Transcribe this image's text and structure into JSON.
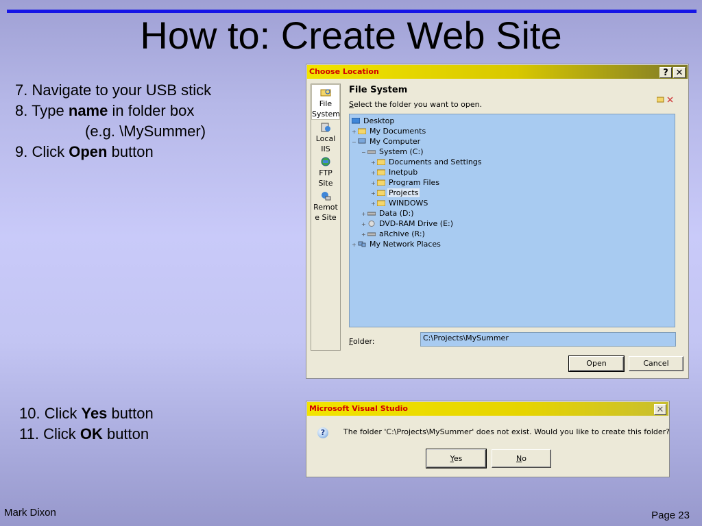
{
  "slide": {
    "title": "How to: Create Web Site",
    "steps_a": {
      "s7": "7. Navigate to your USB stick",
      "s8_pre": "8. Type ",
      "s8_bold": "name",
      "s8_post": " in folder box",
      "s8_example": "(e.g. \\MySummer)",
      "s9_pre": "9. Click ",
      "s9_bold": "Open",
      "s9_post": " button"
    },
    "steps_b": {
      "s10_pre": "10. Click ",
      "s10_bold": "Yes",
      "s10_post": " button",
      "s11_pre": "11. Click ",
      "s11_bold": "OK",
      "s11_post": " button"
    },
    "footer_left": "Mark Dixon",
    "footer_right": "Page 23"
  },
  "choose_location": {
    "title": "Choose Location",
    "help_glyph": "?",
    "close_glyph": "✕",
    "places": [
      {
        "label": "File System",
        "icon": "file-system-icon"
      },
      {
        "label": "Local IIS",
        "icon": "local-iis-icon"
      },
      {
        "label": "FTP Site",
        "icon": "ftp-site-icon"
      },
      {
        "label": "Remot e Site",
        "icon": "remote-site-icon"
      }
    ],
    "heading": "File System",
    "subtitle_mnemonic": "S",
    "subtitle_rest": "elect the folder you want to open.",
    "tree": [
      {
        "label": "Desktop",
        "exp": ""
      },
      {
        "label": "My Documents",
        "exp": "+"
      },
      {
        "label": "My Computer",
        "exp": "−"
      },
      {
        "label": "System (C:)",
        "exp": "−"
      },
      {
        "label": "Documents and Settings",
        "exp": "+"
      },
      {
        "label": "Inetpub",
        "exp": "+"
      },
      {
        "label": "Program Files",
        "exp": "+"
      },
      {
        "label": "Projects",
        "exp": "+"
      },
      {
        "label": "WINDOWS",
        "exp": "+"
      },
      {
        "label": "Data (D:)",
        "exp": "+"
      },
      {
        "label": "DVD-RAM Drive (E:)",
        "exp": "+"
      },
      {
        "label": "aRchive (R:)",
        "exp": "+"
      },
      {
        "label": "My Network Places",
        "exp": "+"
      }
    ],
    "folder_label_mnemonic": "F",
    "folder_label_rest": "older:",
    "folder_value": "C:\\Projects\\MySummer",
    "open_label": "Open",
    "cancel_label": "Cancel"
  },
  "msvs_dialog": {
    "title": "Microsoft Visual Studio",
    "close_glyph": "✕",
    "icon": "question-icon",
    "icon_glyph": "?",
    "message": "The folder 'C:\\Projects\\MySummer' does not exist. Would you like to create this folder?",
    "yes_mnemonic": "Y",
    "yes_rest": "es",
    "no_mnemonic": "N",
    "no_rest": "o"
  },
  "colors": {
    "title_rule": "#1515e6",
    "dialog_title_text": "#d00000",
    "tree_background": "#a8cbf1"
  }
}
